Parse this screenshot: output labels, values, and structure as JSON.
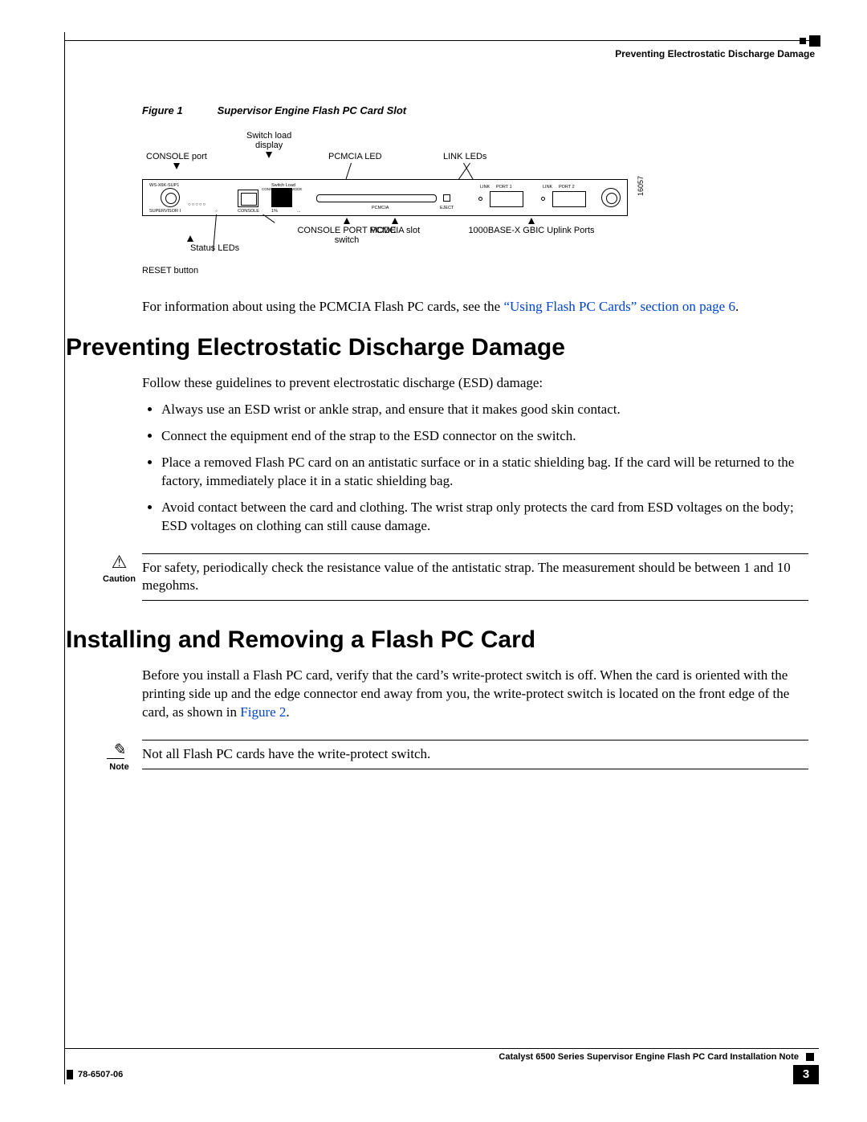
{
  "header": {
    "running_head": "Preventing Electrostatic Discharge Damage"
  },
  "figure1": {
    "label": "Figure 1",
    "caption": "Supervisor Engine Flash PC Card Slot",
    "id_number": "16057",
    "top_callouts": {
      "console_port": "CONSOLE port",
      "switch_load_display_l1": "Switch load",
      "switch_load_display_l2": "display",
      "pcmcia_led": "PCMCIA LED",
      "link_leds": "LINK LEDs"
    },
    "bottom_callouts": {
      "status_leds": "Status LEDs",
      "reset_button": "RESET button",
      "console_port_mode_l1": "CONSOLE PORT MODE",
      "console_port_mode_l2": "switch",
      "pcmcia_slot": "PCMCIA slot",
      "uplink_ports": "1000BASE-X GBIC Uplink Ports"
    },
    "panel_text": {
      "model": "WS-X6K-SUP1",
      "supervisor": "SUPERVISOR I",
      "console_port_mode": "CONSOLE PORT MODE",
      "switch_load": "Switch Load",
      "one_percent": "1%",
      "hundred_percent": "100%",
      "console_lbl": "CONSOLE",
      "pcmcia_lbl": "PCMCIA",
      "eject_lbl": "EJECT",
      "link_lbl": "LINK",
      "port1": "PORT 1",
      "port2": "PORT 2"
    }
  },
  "intro_para": {
    "prefix": "For information about using the PCMCIA Flash PC cards, see the ",
    "xref": "“Using Flash PC Cards” section on page 6",
    "suffix": "."
  },
  "section1": {
    "title": "Preventing Electrostatic Discharge Damage",
    "lead": "Follow these guidelines to prevent electrostatic discharge (ESD) damage:",
    "bullets": [
      "Always use an ESD wrist or ankle strap, and ensure that it makes good skin contact.",
      "Connect the equipment end of the strap to the ESD connector on the switch.",
      "Place a removed Flash PC card on an antistatic surface or in a static shielding bag. If the card will be returned to the factory, immediately place it in a static shielding bag.",
      "Avoid contact between the card and clothing. The wrist strap only protects the card from ESD voltages on the body; ESD voltages on clothing can still cause damage."
    ],
    "caution_label": "Caution",
    "caution_text": "For safety, periodically check the resistance value of the antistatic strap. The measurement should be between 1 and 10 megohms."
  },
  "section2": {
    "title": "Installing and Removing a Flash PC Card",
    "para_prefix": "Before you install a Flash PC card, verify that the card’s write-protect switch is off. When the card is oriented with the printing side up and the edge connector end away from you, the write-protect switch is located on the front edge of the card, as shown in ",
    "para_xref": "Figure 2",
    "para_suffix": ".",
    "note_label": "Note",
    "note_text": "Not all Flash PC cards have the write-protect switch."
  },
  "footer": {
    "doc_title": "Catalyst 6500 Series Supervisor Engine Flash PC Card Installation Note",
    "doc_number": "78-6507-06",
    "page_number": "3"
  }
}
